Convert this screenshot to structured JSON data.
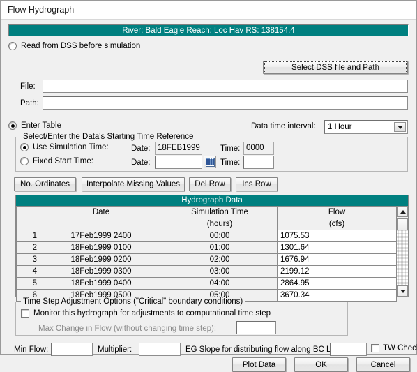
{
  "window": {
    "title": "Flow Hydrograph"
  },
  "banner": {
    "text": "River: Bald Eagle  Reach: Loc Hav  RS: 138154.4"
  },
  "dss": {
    "radio_label": "Read from DSS before simulation",
    "radio_selected": false,
    "select_button": "Select DSS file and Path",
    "file_label": "File:",
    "file_value": "",
    "path_label": "Path:",
    "path_value": ""
  },
  "enter_table": {
    "radio_label": "Enter Table",
    "radio_selected": true,
    "interval_label": "Data time interval:",
    "interval_value": "1 Hour"
  },
  "start_time_ref": {
    "legend": "Select/Enter the Data's Starting Time Reference",
    "use_sim": {
      "label": "Use Simulation Time:",
      "selected": true,
      "date_label": "Date:",
      "date_value": "18FEB1999",
      "time_label": "Time:",
      "time_value": "0000"
    },
    "fixed_start": {
      "label": "Fixed Start Time:",
      "selected": false,
      "date_label": "Date:",
      "date_value": "",
      "time_label": "Time:",
      "time_value": "",
      "calendar_icon": "calendar-icon"
    }
  },
  "table_toolbar": {
    "no_ordinates": "No. Ordinates",
    "interpolate": "Interpolate Missing Values",
    "del_row": "Del Row",
    "ins_row": "Ins Row"
  },
  "hydrograph": {
    "header": "Hydrograph Data",
    "columns": [
      "",
      "Date",
      "Simulation Time",
      "Flow"
    ],
    "units": [
      "",
      "",
      "(hours)",
      "(cfs)"
    ],
    "rows": [
      {
        "n": "1",
        "date": "17Feb1999 2400",
        "time": "00:00",
        "flow": "1075.53"
      },
      {
        "n": "2",
        "date": "18Feb1999 0100",
        "time": "01:00",
        "flow": "1301.64"
      },
      {
        "n": "3",
        "date": "18Feb1999 0200",
        "time": "02:00",
        "flow": "1676.94"
      },
      {
        "n": "4",
        "date": "18Feb1999 0300",
        "time": "03:00",
        "flow": "2199.12"
      },
      {
        "n": "5",
        "date": "18Feb1999 0400",
        "time": "04:00",
        "flow": "2864.95"
      },
      {
        "n": "6",
        "date": "18Feb1999 0500",
        "time": "05:00",
        "flow": "3670.34"
      }
    ],
    "scroll_up_icon": "scroll-up-arrow-icon",
    "scroll_down_icon": "scroll-down-arrow-icon"
  },
  "time_step": {
    "legend": "Time Step Adjustment Options (\"Critical\" boundary conditions)",
    "monitor_label": "Monitor this hydrograph for adjustments to computational time step",
    "monitor_checked": false,
    "max_change_label": "Max Change in Flow (without changing time step):",
    "max_change_value": ""
  },
  "footer": {
    "min_flow_label": "Min Flow:",
    "min_flow_value": "",
    "multiplier_label": "Multiplier:",
    "multiplier_value": "",
    "eg_slope_label": "EG Slope for distributing flow along BC Line:",
    "eg_slope_value": "",
    "tw_check_label": "TW Check",
    "tw_check_checked": false,
    "plot_data": "Plot Data",
    "ok": "OK",
    "cancel": "Cancel"
  },
  "colors": {
    "teal": "#008080",
    "dialog_bg": "#f0f0f0",
    "field_bg": "#ffffff"
  }
}
